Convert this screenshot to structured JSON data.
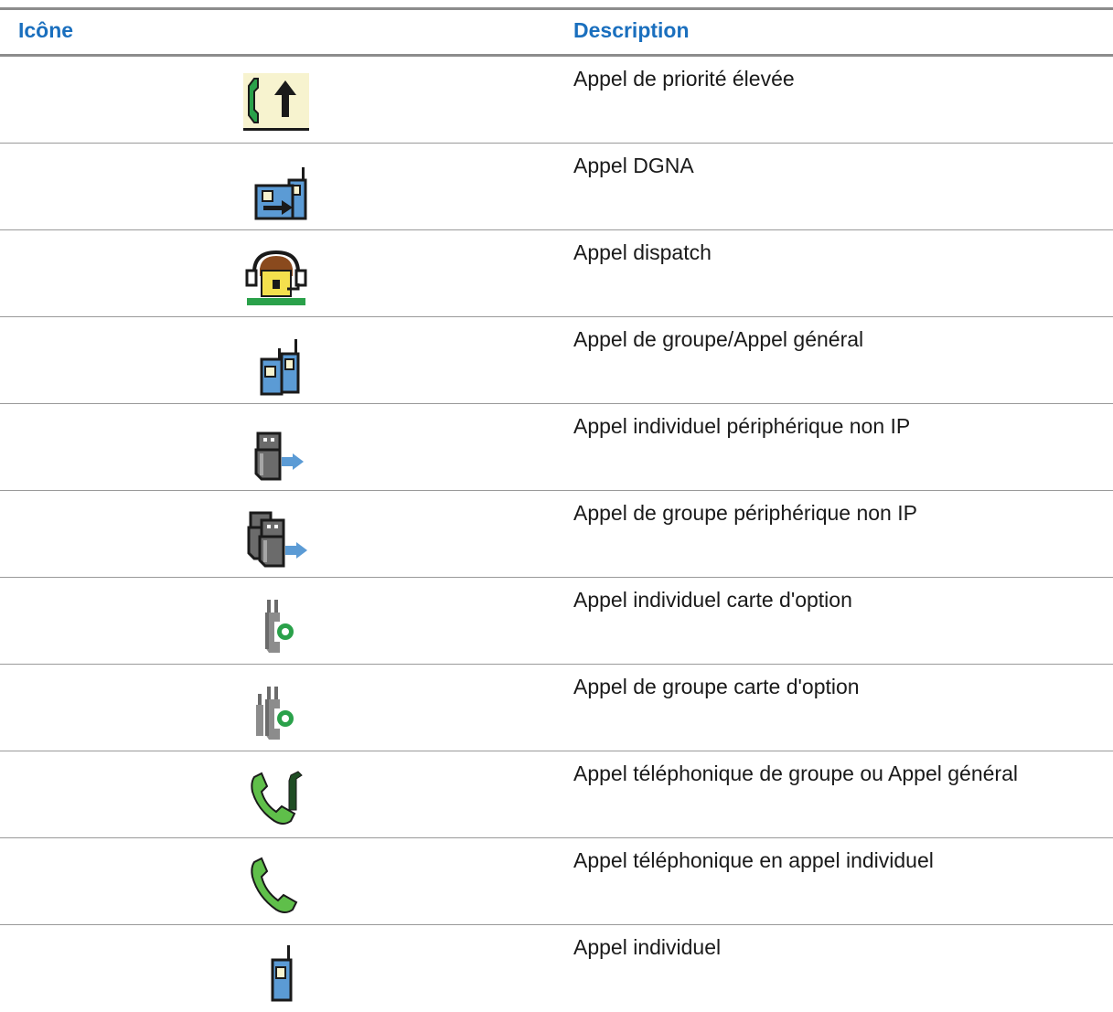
{
  "table": {
    "headers": {
      "icon": "Icône",
      "description": "Description"
    },
    "rows": [
      {
        "icon": "high-priority-call-icon",
        "description": "Appel de priorité élevée"
      },
      {
        "icon": "dgna-call-icon",
        "description": "Appel DGNA"
      },
      {
        "icon": "dispatch-call-icon",
        "description": "Appel dispatch"
      },
      {
        "icon": "group-call-icon",
        "description": "Appel de groupe/Appel général"
      },
      {
        "icon": "non-ip-private-call-icon",
        "description": "Appel individuel périphérique non IP"
      },
      {
        "icon": "non-ip-group-call-icon",
        "description": "Appel de groupe périphérique non IP"
      },
      {
        "icon": "option-board-private-call-icon",
        "description": "Appel individuel carte d'option"
      },
      {
        "icon": "option-board-group-call-icon",
        "description": "Appel de groupe carte d'option"
      },
      {
        "icon": "phone-group-call-icon",
        "description": "Appel téléphonique de groupe ou Appel général"
      },
      {
        "icon": "phone-private-call-icon",
        "description": "Appel téléphonique en appel individuel"
      },
      {
        "icon": "private-call-icon",
        "description": "Appel individuel"
      }
    ]
  }
}
